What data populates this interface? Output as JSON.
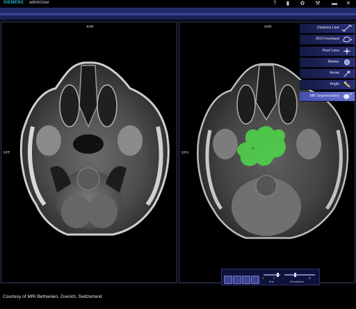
{
  "header": {
    "brand": "SIEMENS",
    "user": "adminUser",
    "icons": [
      "help-icon",
      "document-icon",
      "settings-icon",
      "tools-icon",
      "window-icon",
      "close-icon"
    ]
  },
  "viewports": {
    "left": {
      "top_label": "AHR",
      "left_label": "RPF"
    },
    "right": {
      "top_label": "AHR",
      "left_label": "RPH"
    }
  },
  "tool_menu": {
    "items": [
      {
        "label": "Distance Line",
        "icon": "distance-line-icon"
      },
      {
        "label": "ROI Freehand",
        "icon": "roi-freehand-icon"
      },
      {
        "label": "Pixel Lens",
        "icon": "pixel-lens-icon"
      },
      {
        "label": "Marker",
        "icon": "marker-icon"
      },
      {
        "label": "Arrow",
        "icon": "arrow-icon"
      },
      {
        "label": "Angle",
        "icon": "angle-icon"
      },
      {
        "label": "MR Segmentation",
        "icon": "segmentation-icon",
        "active": true
      }
    ]
  },
  "control_panel": {
    "values": [
      "3",
      "2",
      "10"
    ],
    "labels": [
      "Size",
      "Smoothness"
    ]
  },
  "footer": {
    "credit": "Courtesy of MRI Bethanien, Zuerich, Switzerland"
  },
  "colors": {
    "accent": "#29b7c9",
    "segmentation": "#4fd24a",
    "menu_active": "#5a63c2"
  }
}
